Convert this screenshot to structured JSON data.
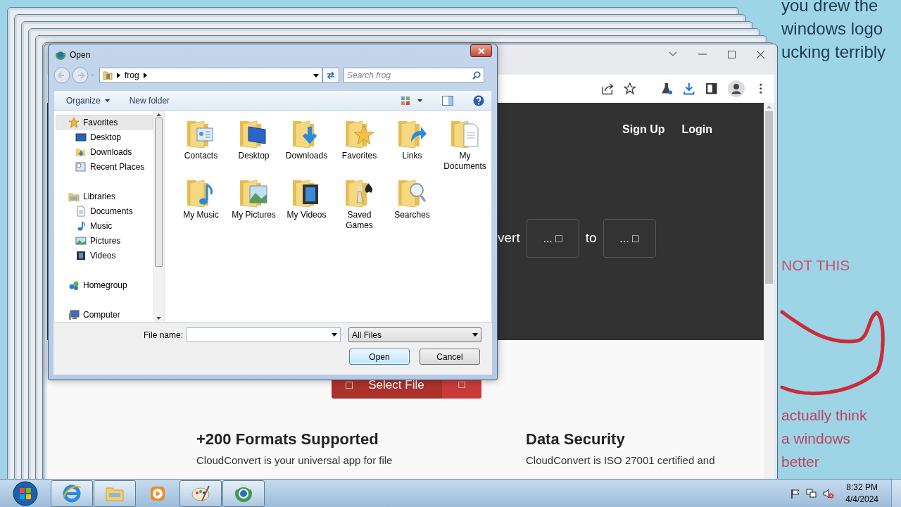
{
  "desktop_notes": [
    {
      "text": "you drew the",
      "color": "#1e3a4a"
    },
    {
      "text": "windows logo",
      "color": "#1e3a4a"
    },
    {
      "text": "ucking terribly",
      "color": "#1e3a4a"
    },
    {
      "text": "NOT THIS",
      "color": "#c8506a"
    },
    {
      "text": "actually think",
      "color": "#c04060"
    },
    {
      "text": "a windows",
      "color": "#c04060"
    },
    {
      "text": "better",
      "color": "#c04060"
    }
  ],
  "browser": {
    "nav_links": [
      "Sign Up",
      "Login"
    ],
    "converter": {
      "lead": "vert",
      "from": "... □",
      "connector": "to",
      "to": "... □"
    },
    "select_button": {
      "icon_left": "□",
      "label": "Select File",
      "icon_right": "□"
    },
    "features": [
      {
        "title": "+200 Formats Supported",
        "text": "CloudConvert is your universal app for file"
      },
      {
        "title": "Data Security",
        "text": "CloudConvert is ISO 27001 certified and"
      }
    ]
  },
  "dialog": {
    "title": "Open",
    "path": [
      "frog"
    ],
    "search": {
      "placeholder": "Search frog"
    },
    "toolbar": [
      {
        "label": "Organize",
        "menu": true
      },
      {
        "label": "New folder",
        "menu": false
      }
    ],
    "nav": [
      {
        "label": "Favorites",
        "kind": "favorites",
        "selected": true,
        "children": [
          {
            "label": "Desktop",
            "kind": "desktop",
            "selected": false
          },
          {
            "label": "Downloads",
            "kind": "downloads",
            "selected": false
          },
          {
            "label": "Recent Places",
            "kind": "recent",
            "selected": false
          }
        ]
      },
      {
        "label": "Libraries",
        "kind": "libraries",
        "selected": false,
        "children": [
          {
            "label": "Documents",
            "kind": "documents",
            "selected": false
          },
          {
            "label": "Music",
            "kind": "music",
            "selected": false
          },
          {
            "label": "Pictures",
            "kind": "pictures",
            "selected": false
          },
          {
            "label": "Videos",
            "kind": "videos",
            "selected": false
          }
        ]
      },
      {
        "label": "Homegroup",
        "kind": "homegroup",
        "selected": false
      },
      {
        "label": "Computer",
        "kind": "computer",
        "selected": false
      }
    ],
    "items": [
      {
        "label": "Contacts",
        "kind": "contacts"
      },
      {
        "label": "Desktop",
        "kind": "desktop"
      },
      {
        "label": "Downloads",
        "kind": "downloads"
      },
      {
        "label": "Favorites",
        "kind": "favorites"
      },
      {
        "label": "Links",
        "kind": "links"
      },
      {
        "label": "My Documents",
        "kind": "documents"
      },
      {
        "label": "My Music",
        "kind": "music"
      },
      {
        "label": "My Pictures",
        "kind": "pictures"
      },
      {
        "label": "My Videos",
        "kind": "videos"
      },
      {
        "label": "Saved Games",
        "kind": "games"
      },
      {
        "label": "Searches",
        "kind": "searches"
      }
    ],
    "file_name": {
      "label": "File name:"
    },
    "file_type": "All Files",
    "buttons": [
      {
        "label": "Open",
        "default": true
      },
      {
        "label": "Cancel",
        "default": false
      }
    ]
  },
  "taskbar": {
    "apps": [
      {
        "kind": "ie",
        "running": true
      },
      {
        "kind": "explorer",
        "running": true
      },
      {
        "kind": "media",
        "running": false
      },
      {
        "kind": "paint",
        "running": true
      },
      {
        "kind": "chrome",
        "running": true
      }
    ],
    "time": "8:32 PM",
    "date": "4/4/2024"
  }
}
